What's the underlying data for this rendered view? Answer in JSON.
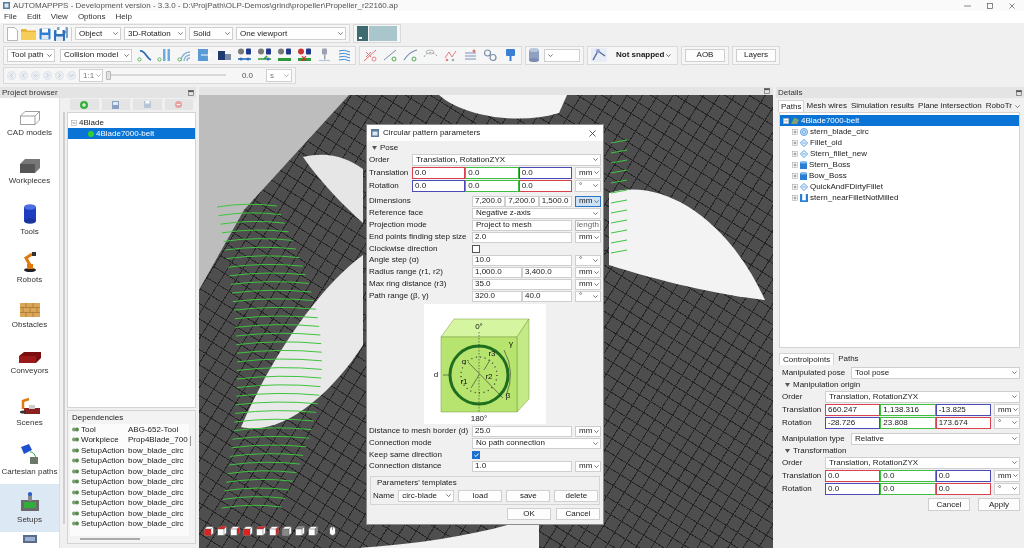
{
  "window": {
    "title": "AUTOMAPPPS - Development version - 3.3.0 - D:\\ProjPath\\OLP-Demos\\grind\\propeller\\Propeller_r22160.ap"
  },
  "menu": [
    "File",
    "Edit",
    "View",
    "Options",
    "Help"
  ],
  "toolbar": {
    "view_combos": [
      "Object",
      "3D-Rotation",
      "Solid",
      "One viewport"
    ],
    "display_combos": [
      "Tool path",
      "Collision model"
    ],
    "snap": "Not snapped",
    "buttons": [
      "AOB",
      "Layers"
    ]
  },
  "playback": {
    "disabled": true,
    "speed": "1:1",
    "level": 0,
    "time": "0.0",
    "unit": "s"
  },
  "project_browser": {
    "title": "Project browser",
    "categories": [
      {
        "label": "CAD models",
        "kind": "outline",
        "selected": false
      },
      {
        "label": "Workpieces",
        "kind": "block",
        "selected": false
      },
      {
        "label": "Tools",
        "kind": "cylinder",
        "selected": false
      },
      {
        "label": "Robots",
        "kind": "robot",
        "selected": false
      },
      {
        "label": "Obstacles",
        "kind": "bricks",
        "selected": false
      },
      {
        "label": "Conveyors",
        "kind": "slab",
        "selected": false
      },
      {
        "label": "Scenes",
        "kind": "cell",
        "selected": false
      },
      {
        "label": "Cartesian paths",
        "kind": "path",
        "selected": false
      },
      {
        "label": "Setups",
        "kind": "machine",
        "selected": true
      }
    ],
    "tree": [
      {
        "label": "4Blade",
        "expanded": true,
        "selected": false,
        "children": [
          {
            "label": "4Blade7000-belt",
            "kind": "dot",
            "selected": true
          }
        ]
      }
    ]
  },
  "dependencies": {
    "title": "Dependencies",
    "rows": [
      {
        "type": "Tool",
        "name": "ABG-652-Tool"
      },
      {
        "type": "Workpiece",
        "name": "Prop4Blade_700"
      },
      {
        "type": "SetupAction",
        "name": "bow_blade_circ"
      },
      {
        "type": "SetupAction",
        "name": "bow_blade_circ"
      },
      {
        "type": "SetupAction",
        "name": "bow_blade_circ"
      },
      {
        "type": "SetupAction",
        "name": "bow_blade_circ"
      },
      {
        "type": "SetupAction",
        "name": "bow_blade_circ"
      },
      {
        "type": "SetupAction",
        "name": "bow_blade_circ"
      },
      {
        "type": "SetupAction",
        "name": "bow_blade_circ"
      },
      {
        "type": "SetupAction",
        "name": "bow_blade_circ"
      }
    ]
  },
  "dialog": {
    "title": "Circular pattern parameters",
    "pose": {
      "title": "Pose",
      "expanded": true,
      "order": {
        "label": "Order",
        "value": "Translation, RotationZYX"
      },
      "rows": [
        {
          "label": "Translation",
          "values": [
            {
              "value": "0.0",
              "color": "#d9414e"
            },
            {
              "value": "0.0",
              "color": "#3fbf3f"
            },
            {
              "value": "0.0",
              "color": "#4a4ab8"
            }
          ],
          "unit": "mm"
        },
        {
          "label": "Rotation",
          "values": [
            {
              "value": "0.0",
              "color": "#4a4ab8"
            },
            {
              "value": "0.0",
              "color": "#3fbf3f"
            },
            {
              "value": "0.0",
              "color": "#d9414e"
            }
          ],
          "unit": "°"
        }
      ]
    },
    "fields": [
      {
        "kind": "values",
        "label": "Dimensions",
        "values": [
          "7,200.0",
          "7,200.0",
          "1,500.0"
        ],
        "unit": "mm",
        "focused": true
      },
      {
        "kind": "combo",
        "label": "Reference face",
        "value": "Negative z-axis"
      },
      {
        "kind": "combo",
        "label": "Projection mode",
        "value": "Project to mesh",
        "tooltip": "length"
      },
      {
        "kind": "values",
        "label": "End points finding step size",
        "values": [
          "2.0"
        ],
        "unit": "mm",
        "focused": false
      },
      {
        "kind": "check",
        "label": "Clockwise direction",
        "checked": false
      },
      {
        "kind": "values",
        "label": "Angle step (α)",
        "values": [
          "10.0"
        ],
        "unit": "°",
        "focused": false
      },
      {
        "kind": "values",
        "label": "Radius range (r1, r2)",
        "values": [
          "1,000.0",
          "3,400.0"
        ],
        "unit": "mm",
        "focused": false
      },
      {
        "kind": "values",
        "label": "Max ring distance (r3)",
        "values": [
          "35.0"
        ],
        "unit": "mm",
        "focused": false
      },
      {
        "kind": "values",
        "label": "Path range (β, γ)",
        "values": [
          "320.0",
          "40.0"
        ],
        "unit": "°",
        "focused": false
      },
      {
        "kind": "diagram",
        "labels": [
          "0°",
          "180°",
          "r1",
          "r2",
          "r3",
          "α",
          "β",
          "γ",
          "d"
        ]
      },
      {
        "kind": "values",
        "label": "Distance to mesh border (d)",
        "values": [
          "25.0"
        ],
        "unit": "mm",
        "focused": false
      },
      {
        "kind": "combo",
        "label": "Connection mode",
        "value": "No path connection"
      },
      {
        "kind": "check",
        "label": "Keep same direction",
        "checked": true
      },
      {
        "kind": "values",
        "label": "Connection distance",
        "values": [
          "1.0"
        ],
        "unit": "mm",
        "focused": false
      }
    ],
    "templates": {
      "title": "Parameters' templates",
      "name_label": "Name",
      "name": "circ-blade",
      "buttons": [
        "load",
        "save",
        "delete"
      ]
    },
    "buttons": [
      "OK",
      "Cancel"
    ]
  },
  "details": {
    "title": "Details",
    "tabs": [
      {
        "label": "Paths",
        "selected": true
      },
      {
        "label": "Mesh wires",
        "selected": false
      },
      {
        "label": "Simulation results",
        "selected": false
      },
      {
        "label": "Plane intersection",
        "selected": false
      },
      {
        "label": "RoboTr",
        "selected": false
      }
    ],
    "tree": [
      {
        "label": "4Blade7000-belt",
        "kind": "mesh",
        "selected": true,
        "expanded": true,
        "children": [
          {
            "label": "stern_blade_circ",
            "kind": "circle",
            "selected": false,
            "expanded": false
          },
          {
            "label": "Fillet_old",
            "kind": "diamond",
            "selected": false,
            "expanded": false
          },
          {
            "label": "Stern_fillet_new",
            "kind": "diamond",
            "selected": false,
            "expanded": false
          },
          {
            "label": "Stern_Boss",
            "kind": "cylinder",
            "selected": false,
            "expanded": false
          },
          {
            "label": "Bow_Boss",
            "kind": "cylinder",
            "selected": false,
            "expanded": false
          },
          {
            "label": "QuickAndFDirtyFillet",
            "kind": "diamond",
            "selected": false,
            "expanded": false
          },
          {
            "label": "stern_nearFilletNotMilled",
            "kind": "bars",
            "selected": false,
            "expanded": false
          }
        ]
      }
    ],
    "editor": {
      "tabs": [
        {
          "label": "Controlpoints",
          "selected": true
        },
        {
          "label": "Paths",
          "selected": false
        }
      ],
      "pose": {
        "label": "Manipulated pose",
        "value": "Tool pose"
      },
      "origin": {
        "title": "Manipulation origin",
        "expanded": true,
        "order": {
          "label": "Order",
          "value": "Translation, RotationZYX"
        },
        "rows": [
          {
            "label": "Translation",
            "values": [
              {
                "value": "660.247",
                "color": "#d9414e"
              },
              {
                "value": "1,138.316",
                "color": "#3fbf3f"
              },
              {
                "value": "-13.825",
                "color": "#4a4ab8"
              }
            ],
            "unit": "mm"
          },
          {
            "label": "Rotation",
            "values": [
              {
                "value": "-28.726",
                "color": "#4a4ab8"
              },
              {
                "value": "23.808",
                "color": "#3fbf3f"
              },
              {
                "value": "173.674",
                "color": "#d9414e"
              }
            ],
            "unit": "°"
          }
        ]
      },
      "type": {
        "label": "Manipulation type",
        "value": "Relative"
      },
      "transformation": {
        "title": "Transformation",
        "expanded": true,
        "order": {
          "label": "Order",
          "value": "Translation, RotationZYX"
        },
        "rows": [
          {
            "label": "Translation",
            "values": [
              {
                "value": "0.0",
                "color": "#d9414e"
              },
              {
                "value": "0.0",
                "color": "#3fbf3f"
              },
              {
                "value": "0.0",
                "color": "#4a4ab8"
              }
            ],
            "unit": "mm"
          },
          {
            "label": "Rotation",
            "values": [
              {
                "value": "0.0",
                "color": "#4a4ab8"
              },
              {
                "value": "0.0",
                "color": "#3fbf3f"
              },
              {
                "value": "0.0",
                "color": "#d9414e"
              }
            ],
            "unit": "°"
          }
        ]
      },
      "buttons": [
        "Cancel",
        "Apply"
      ]
    }
  }
}
